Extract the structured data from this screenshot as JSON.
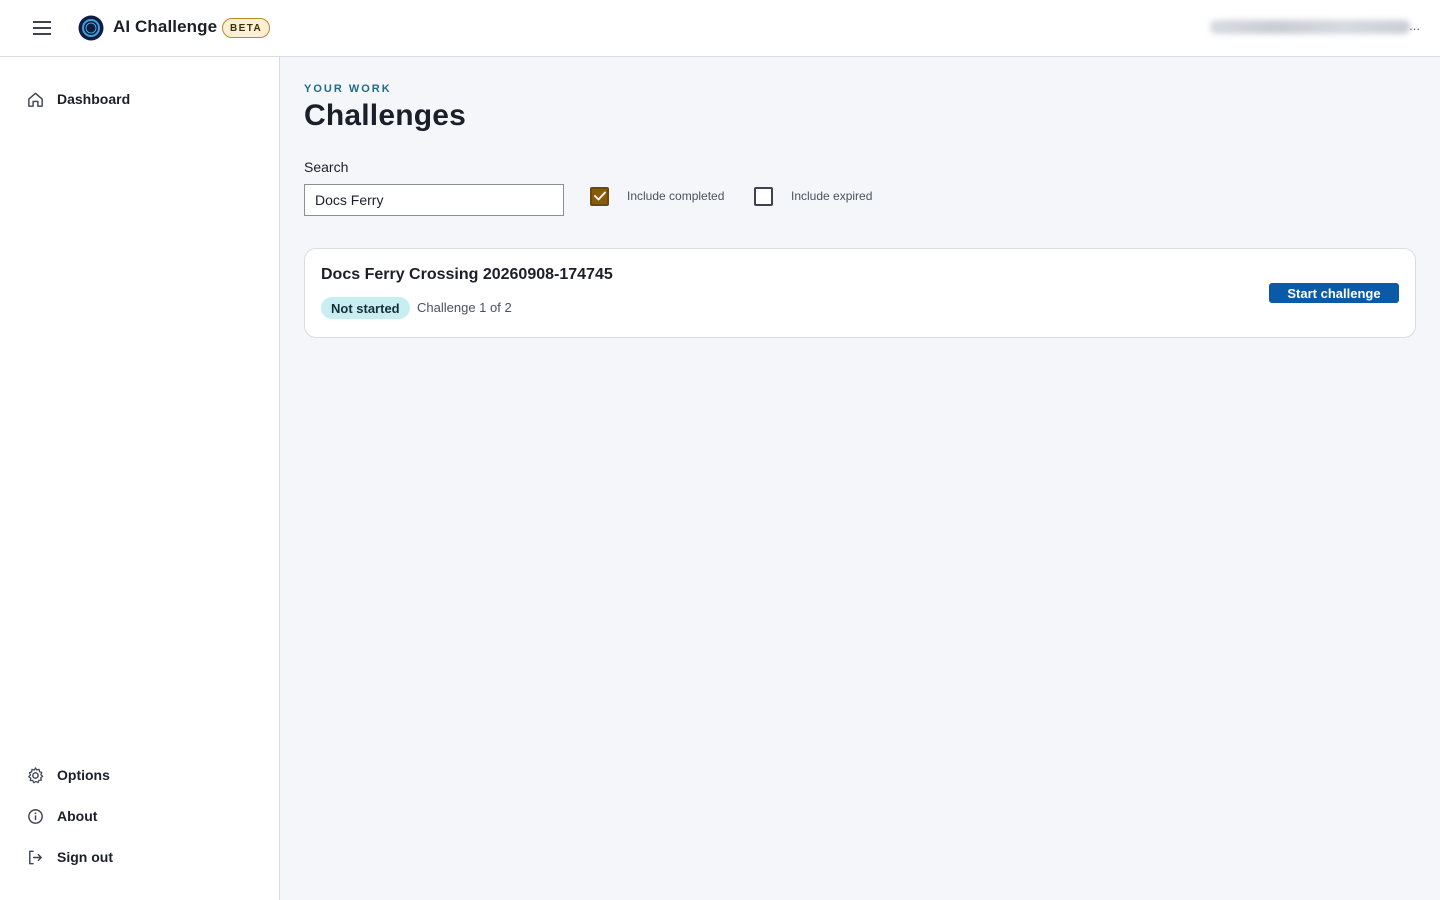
{
  "header": {
    "app_title": "AI Challenge",
    "badge": "BETA",
    "user_suffix": "..."
  },
  "sidebar": {
    "items": [
      {
        "label": "Dashboard",
        "icon": "home-icon"
      },
      {
        "label": "Options",
        "icon": "gear-icon"
      },
      {
        "label": "About",
        "icon": "info-icon"
      },
      {
        "label": "Sign out",
        "icon": "sign-out-icon"
      }
    ]
  },
  "main": {
    "eyebrow": "YOUR WORK",
    "title": "Challenges",
    "search": {
      "label": "Search",
      "value": "Docs Ferry"
    },
    "filters": {
      "include_completed": {
        "label": "Include completed",
        "checked": true
      },
      "include_expired": {
        "label": "Include expired",
        "checked": false
      }
    },
    "challenges": [
      {
        "title": "Docs Ferry Crossing 20260908-174745",
        "status": "Not started",
        "progress": "Challenge 1 of 2",
        "action": "Start challenge"
      }
    ]
  },
  "colors": {
    "accent": "#0a5aa8",
    "checkbox_checked": "#8a5a0a",
    "status_badge_bg": "#c8eef2",
    "eyebrow": "#1f6c86",
    "beta_badge_bg": "#fbf0d4"
  }
}
